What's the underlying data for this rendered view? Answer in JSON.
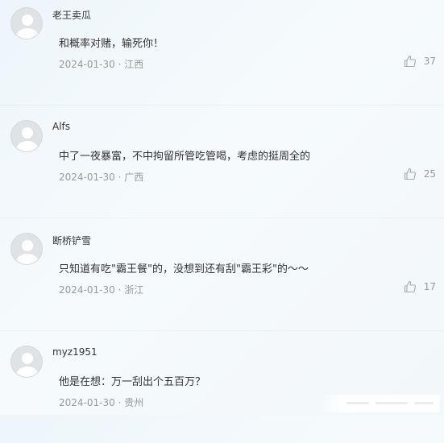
{
  "comments": [
    {
      "username": "老王卖瓜",
      "text": "和概率对赌，输死你！",
      "date": "2024-01-30",
      "location": "江西",
      "likes": "37"
    },
    {
      "username": "Alfs",
      "text": "中了一夜暴富，不中拘留所管吃管喝，考虑的挺周全的",
      "date": "2024-01-30",
      "location": "广西",
      "likes": "25"
    },
    {
      "username": "断桥铲雪",
      "text": "只知道有吃\"霸王餐\"的，没想到还有刮\"霸王彩\"的～～",
      "date": "2024-01-30",
      "location": "浙江",
      "likes": "17"
    },
    {
      "username": "myz1951",
      "text": "他是在想：万一刮出个五百万？",
      "date": "2024-01-30",
      "location": "贵州",
      "likes": ""
    }
  ],
  "meta_separator": " · ",
  "icons": {
    "avatar": "default-avatar-icon",
    "like": "thumbs-up-icon"
  },
  "colors": {
    "text": "#333333",
    "meta": "#999999",
    "avatar_bg": "#dfe3e6"
  }
}
